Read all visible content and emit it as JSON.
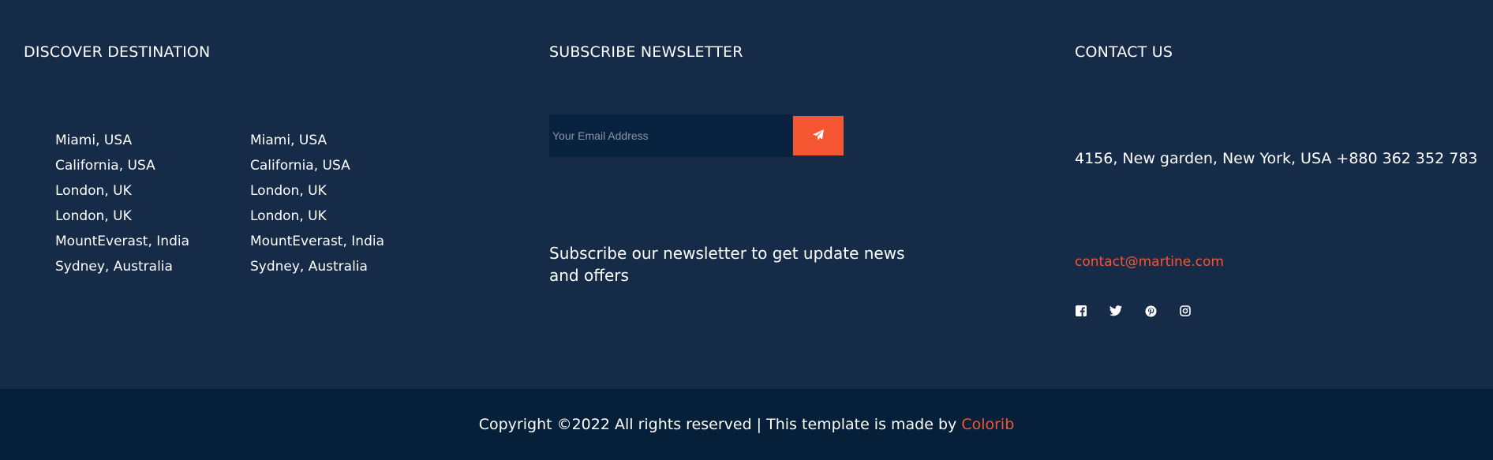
{
  "discover": {
    "title": "DISCOVER DESTINATION",
    "column1": [
      "Miami, USA",
      "California, USA",
      "London, UK",
      "London, UK",
      "MountEverast, India",
      "Sydney, Australia"
    ],
    "column2": [
      "Miami, USA",
      "California, USA",
      "London, UK",
      "London, UK",
      "MountEverast, India",
      "Sydney, Australia"
    ]
  },
  "newsletter": {
    "title": "SUBSCRIBE NEWSLETTER",
    "email_placeholder": "Your Email Address",
    "send_icon": "paper-plane-icon",
    "description": "Subscribe our newsletter to get update news and offers"
  },
  "contact": {
    "title": "CONTACT US",
    "address": "4156, New garden, New York, USA +880 362 352 783",
    "email": "contact@martine.com",
    "socials": [
      "facebook-icon",
      "twitter-icon",
      "pinterest-icon",
      "instagram-icon"
    ]
  },
  "footer": {
    "copyright_prefix": "Copyright ©2022 All rights reserved | This template is made by ",
    "author": "Colorib"
  },
  "colors": {
    "background": "#162b48",
    "bottom_bar": "#06203a",
    "accent": "#f45631",
    "input_bg": "#06223f"
  }
}
